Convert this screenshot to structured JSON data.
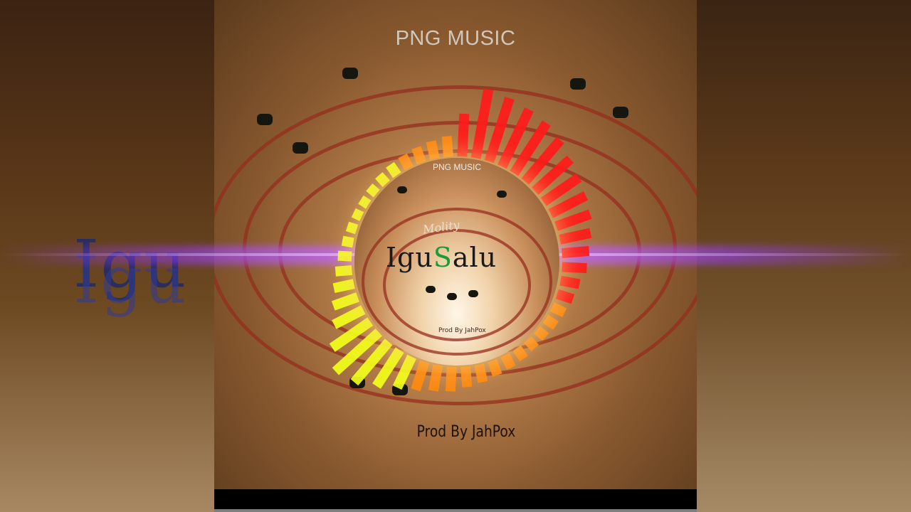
{
  "watermark": "PNG MUSIC",
  "cover": {
    "watermark": "PNG MUSIC",
    "artist": "Molity",
    "title_parts": [
      "Igu",
      "S",
      "alu"
    ],
    "producer": "Prod By JahPox"
  },
  "background_title": "Igu",
  "producer_credit": "Prod By JahPox",
  "visualizer": {
    "levels": [
      0.55,
      0.95,
      0.9,
      0.85,
      0.8,
      0.72,
      0.62,
      0.55,
      0.5,
      0.45,
      0.38,
      0.32,
      0.28,
      0.2,
      0.16,
      0.12,
      0.1,
      0.08,
      0.08,
      0.1,
      0.12,
      0.14,
      0.18,
      0.22,
      0.28,
      0.3,
      0.35,
      0.42,
      0.55,
      0.7,
      0.78,
      0.6,
      0.4,
      0.3,
      0.22,
      0.16,
      0.12,
      0.08,
      0.06,
      0.05,
      0.05,
      0.06,
      0.08,
      0.1,
      0.12,
      0.15,
      0.18,
      0.22
    ],
    "colors": {
      "high": "#ff1a1a",
      "mid": "#ff8a10",
      "low": "#f2ff1a"
    }
  }
}
